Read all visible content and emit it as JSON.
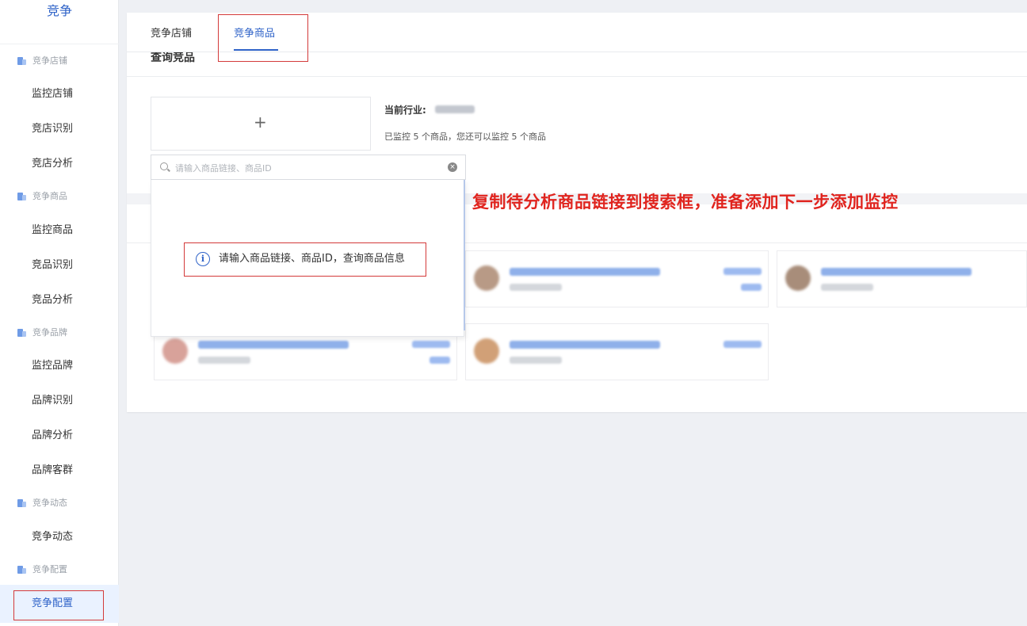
{
  "sidebar": {
    "title": "竞争",
    "groups": [
      {
        "label": "竞争店铺",
        "items": [
          "监控店铺",
          "竞店识别",
          "竞店分析"
        ]
      },
      {
        "label": "竞争商品",
        "items": [
          "监控商品",
          "竞品识别",
          "竞品分析"
        ]
      },
      {
        "label": "竞争品牌",
        "items": [
          "监控品牌",
          "品牌识别",
          "品牌分析",
          "品牌客群"
        ]
      },
      {
        "label": "竞争动态",
        "items": [
          "竞争动态"
        ]
      },
      {
        "label": "竞争配置",
        "items": [
          "竞争配置"
        ]
      }
    ],
    "active_item": "竞争配置"
  },
  "tabs": [
    {
      "label": "竞争店铺",
      "active": false
    },
    {
      "label": "竞争商品",
      "active": true
    }
  ],
  "section_title": "查询竞品",
  "add_button": "+",
  "industry": {
    "label": "当前行业:"
  },
  "monitor_status": "已监控 5 个商品，您还可以监控 5 个商品",
  "search": {
    "placeholder": "请输入商品链接、商品ID",
    "hint": "请输入商品链接、商品ID，查询商品信息"
  },
  "annotation": "复制待分析商品链接到搜索框，准备添加下一步添加监控",
  "icons": {
    "search": "search-icon",
    "clear": "clear-icon",
    "info": "info-icon",
    "group": "building-icon",
    "add": "plus-icon"
  },
  "colors": {
    "accent": "#2f63c8",
    "highlight_box": "#d33a3a",
    "annotation": "#e0241e",
    "active_bg": "#eaf2ff"
  }
}
